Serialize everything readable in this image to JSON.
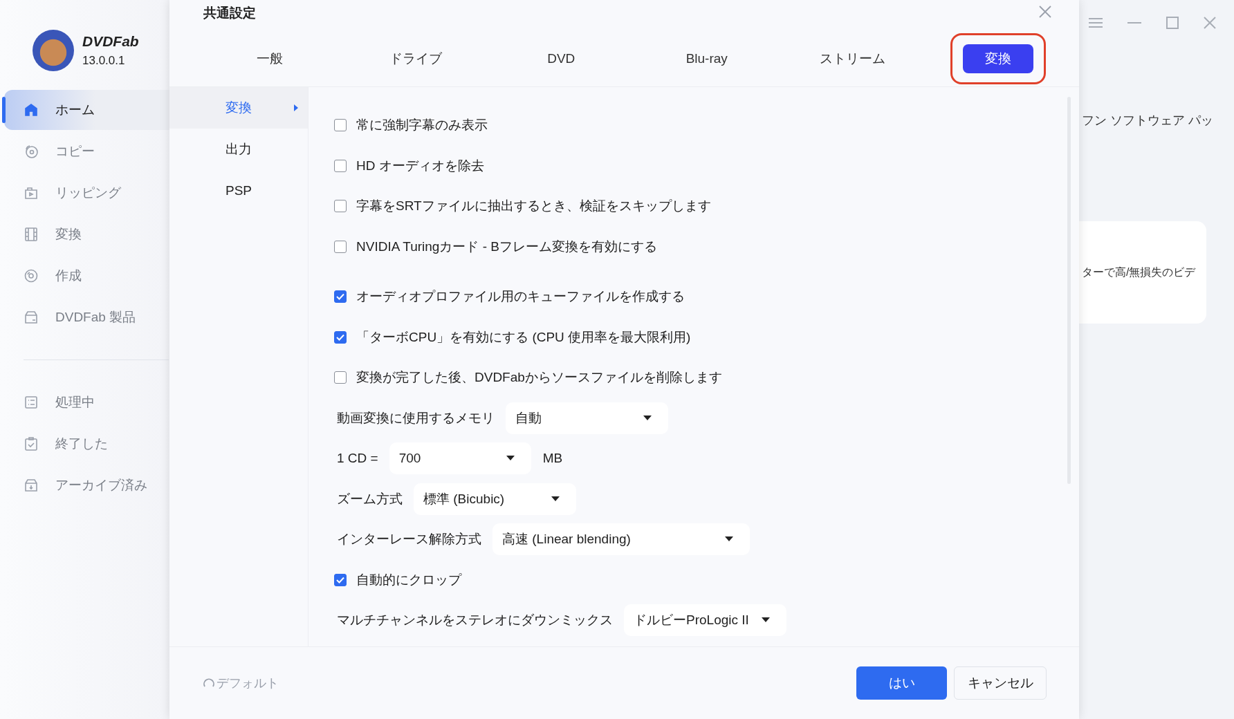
{
  "app": {
    "name": "DVDFab",
    "version": "13.0.0.1"
  },
  "sidebar": {
    "items": [
      {
        "label": "ホーム",
        "selected": true
      },
      {
        "label": "コピー",
        "selected": false
      },
      {
        "label": "リッピング",
        "selected": false
      },
      {
        "label": "変換",
        "selected": false
      },
      {
        "label": "作成",
        "selected": false
      },
      {
        "label": "DVDFab 製品",
        "selected": false
      }
    ],
    "queue_items": [
      {
        "label": "処理中",
        "selected": false
      },
      {
        "label": "終了した",
        "selected": false
      },
      {
        "label": "アーカイブ済み",
        "selected": false
      }
    ]
  },
  "background": {
    "banner_text": "フン ソフトウェア パッ",
    "card_text": "ターで高/無損失のビデ"
  },
  "dialog": {
    "title": "共通設定",
    "tabs": [
      {
        "label": "一般",
        "selected": false
      },
      {
        "label": "ドライブ",
        "selected": false
      },
      {
        "label": "DVD",
        "selected": false
      },
      {
        "label": "Blu-ray",
        "selected": false
      },
      {
        "label": "ストリーム",
        "selected": false
      },
      {
        "label": "変換",
        "selected": true
      }
    ],
    "subnav": [
      {
        "label": "変換",
        "selected": true
      },
      {
        "label": "出力",
        "selected": false
      },
      {
        "label": "PSP",
        "selected": false
      }
    ],
    "settings_groups": [
      [
        {
          "kind": "checkbox",
          "label": "常に強制字幕のみ表示",
          "checked": false
        },
        {
          "kind": "checkbox",
          "label": "HD オーディオを除去",
          "checked": false
        },
        {
          "kind": "checkbox",
          "label": "字幕をSRTファイルに抽出するとき、検証をスキップします",
          "checked": false
        },
        {
          "kind": "checkbox",
          "label": "NVIDIA Turingカード - Bフレーム変換を有効にする",
          "checked": false
        }
      ],
      [
        {
          "kind": "checkbox",
          "label": "オーディオプロファイル用のキューファイルを作成する",
          "checked": true
        },
        {
          "kind": "checkbox",
          "label": "「ターボCPU」を有効にする (CPU 使用率を最大限利用)",
          "checked": true
        },
        {
          "kind": "checkbox",
          "label": "変換が完了した後、DVDFabからソースファイルを削除します",
          "checked": false
        },
        {
          "kind": "select",
          "label": "動画変換に使用するメモリ",
          "value": "自動"
        },
        {
          "kind": "select",
          "label": "1 CD =",
          "value": "700",
          "unit": "MB"
        },
        {
          "kind": "select",
          "label": "ズーム方式",
          "value": "標準 (Bicubic)"
        },
        {
          "kind": "select",
          "label": "インターレース解除方式",
          "value": "高速 (Linear blending)"
        },
        {
          "kind": "checkbox",
          "label": "自動的にクロップ",
          "checked": true
        },
        {
          "kind": "select",
          "label": "マルチチャンネルをステレオにダウンミックス",
          "value": "ドルビーProLogic II"
        }
      ]
    ],
    "default_button": "デフォルト",
    "buttons": [
      {
        "label": "はい",
        "kind": "primary"
      },
      {
        "label": "キャンセル",
        "kind": "secondary"
      }
    ]
  }
}
